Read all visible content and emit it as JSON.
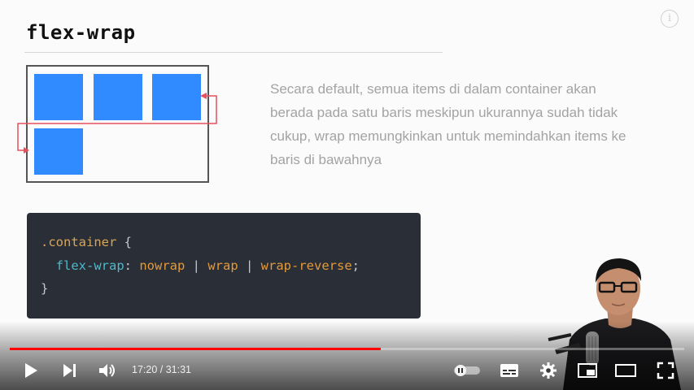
{
  "slide": {
    "title": "flex-wrap",
    "description": "Secara default, semua items di dalam container akan berada pada satu baris meskipun ukurannya sudah tidak cukup, wrap memungkinkan untuk memindahkan items ke baris di bawahnya",
    "code": {
      "line1_selector": ".container",
      "line1_brace": " {",
      "line2_indent": "  ",
      "line2_property": "flex-wrap",
      "line2_colon": ": ",
      "line2_value1": "nowrap",
      "line2_sep1": " | ",
      "line2_value2": "wrap",
      "line2_sep2": " | ",
      "line2_value3": "wrap-reverse",
      "line2_end": ";",
      "line3": "}"
    }
  },
  "player": {
    "time_current": "17:20",
    "time_total": "31:31",
    "time_display": "17:20 / 31:31",
    "progress_fraction": 0.55,
    "accent_color": "#ff0000",
    "icons": [
      "play-icon",
      "next-icon",
      "volume-icon",
      "autoplay-toggle-icon",
      "subtitles-icon",
      "settings-icon",
      "miniplayer-icon",
      "theater-icon",
      "fullscreen-icon",
      "info-icon"
    ]
  }
}
